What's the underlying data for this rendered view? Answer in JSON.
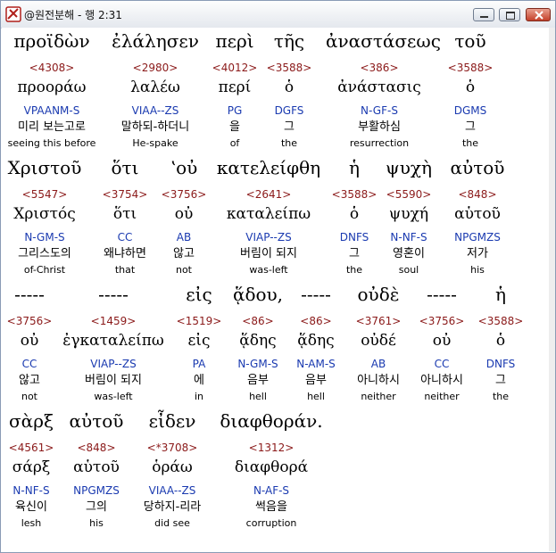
{
  "window": {
    "title": "@원전분해 - 행 2:31",
    "buttons": {
      "minimize": "–",
      "maximize": "▢",
      "close": "✕"
    }
  },
  "rows": [
    {
      "words": [
        {
          "greek": "προϊδὼν",
          "strongs": "<4308>",
          "lemma": "προοράω",
          "parse": "VPAANM-S",
          "korean": "미리 보는고로",
          "english": "seeing this before"
        },
        {
          "greek": "ἐλάλησεν",
          "strongs": "<2980>",
          "lemma": "λαλέω",
          "parse": "VIAA--ZS",
          "korean": "말하되-하더니",
          "english": "He-spake"
        },
        {
          "greek": "περὶ",
          "strongs": "<4012>",
          "lemma": "περί",
          "parse": "PG",
          "korean": "을",
          "english": "of"
        },
        {
          "greek": "τῆς",
          "strongs": "<3588>",
          "lemma": "ὁ",
          "parse": "DGFS",
          "korean": "그",
          "english": "the"
        },
        {
          "greek": "ἀναστάσεως",
          "strongs": "<386>",
          "lemma": "ἀνάστασις",
          "parse": "N-GF-S",
          "korean": "부활하심",
          "english": "resurrection"
        },
        {
          "greek": "τοῦ",
          "strongs": "<3588>",
          "lemma": "ὁ",
          "parse": "DGMS",
          "korean": "그",
          "english": "the"
        }
      ]
    },
    {
      "words": [
        {
          "greek": "Χριστοῦ",
          "strongs": "<5547>",
          "lemma": "Χριστός",
          "parse": "N-GM-S",
          "korean": "그리스도의",
          "english": "of-Christ"
        },
        {
          "greek": "ὅτι",
          "strongs": "<3754>",
          "lemma": "ὅτι",
          "parse": "CC",
          "korean": "왜냐하면",
          "english": "that"
        },
        {
          "greek": "ʽοὐ",
          "strongs": "<3756>",
          "lemma": "οὐ",
          "parse": "AB",
          "korean": "않고",
          "english": "not"
        },
        {
          "greek": "κατελείφθη",
          "strongs": "<2641>",
          "lemma": "καταλείπω",
          "parse": "VIAP--ZS",
          "korean": "버림이 되지",
          "english": "was-left"
        },
        {
          "greek": "ἡ",
          "strongs": "<3588>",
          "lemma": "ὁ",
          "parse": "DNFS",
          "korean": "그",
          "english": "the"
        },
        {
          "greek": "ψυχὴ",
          "strongs": "<5590>",
          "lemma": "ψυχή",
          "parse": "N-NF-S",
          "korean": "영혼이",
          "english": "soul"
        },
        {
          "greek": "αὐτοῦ",
          "strongs": "<848>",
          "lemma": "αὑτοῦ",
          "parse": "NPGMZS",
          "korean": "저가",
          "english": "his"
        }
      ]
    },
    {
      "words": [
        {
          "greek": "-----",
          "strongs": "<3756>",
          "lemma": "οὐ",
          "parse": "CC",
          "korean": "않고",
          "english": "not"
        },
        {
          "greek": "-----",
          "strongs": "<1459>",
          "lemma": "ἐγκαταλείπω",
          "parse": "VIAP--ZS",
          "korean": "버림이 되지",
          "english": "was-left"
        },
        {
          "greek": "εἰς",
          "strongs": "<1519>",
          "lemma": "εἰς",
          "parse": "PA",
          "korean": "에",
          "english": "in"
        },
        {
          "greek": "ᾅδου,",
          "strongs": "<86>",
          "lemma": "ᾅδης",
          "parse": "N-GM-S",
          "korean": "음부",
          "english": "hell"
        },
        {
          "greek": "-----",
          "strongs": "<86>",
          "lemma": "ᾅδης",
          "parse": "N-AM-S",
          "korean": "음부",
          "english": "hell"
        },
        {
          "greek": "οὐδὲ",
          "strongs": "<3761>",
          "lemma": "οὐδέ",
          "parse": "AB",
          "korean": "아니하시",
          "english": "neither"
        },
        {
          "greek": "-----",
          "strongs": "<3756>",
          "lemma": "οὐ",
          "parse": "CC",
          "korean": "아니하시",
          "english": "neither"
        },
        {
          "greek": "ἡ",
          "strongs": "<3588>",
          "lemma": "ὁ",
          "parse": "DNFS",
          "korean": "그",
          "english": "the"
        }
      ]
    },
    {
      "words": [
        {
          "greek": "σὰρξ",
          "strongs": "<4561>",
          "lemma": "σάρξ",
          "parse": "N-NF-S",
          "korean": "육신이",
          "english": "lesh"
        },
        {
          "greek": "αὐτοῦ",
          "strongs": "<848>",
          "lemma": "αὑτοῦ",
          "parse": "NPGMZS",
          "korean": "그의",
          "english": "his"
        },
        {
          "greek": "εἶδεν",
          "strongs": "<*3708>",
          "lemma": "ὁράω",
          "parse": "VIAA--ZS",
          "korean": "당하지-리라",
          "english": "did see"
        },
        {
          "greek": "διαφθοράν.",
          "strongs": "<1312>",
          "lemma": "διαφθορά",
          "parse": "N-AF-S",
          "korean": "썩음을",
          "english": "corruption"
        }
      ]
    }
  ],
  "colors": {
    "strongs": "#8b1a1a",
    "parse": "#1a3ab0",
    "text": "#000000"
  }
}
